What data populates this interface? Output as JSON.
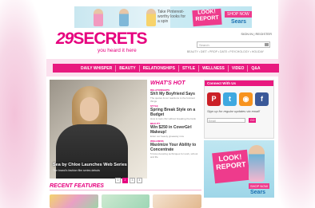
{
  "top_ad": {
    "tagline": "Take Pinterest-worthy looks for a spin",
    "look_report": "LOOK! REPORT",
    "shop_now": "SHOP NOW",
    "brand": "Sears"
  },
  "header": {
    "logo_number": "29",
    "logo_word": "SECRETS",
    "tagline": "you heard it here",
    "sign_in": "SIGN IN | REGISTER",
    "search_placeholder": "Search",
    "trending": "BEAUTY • DIET • PROP • DATE • PSYCHOLOGY • HOLIDAY"
  },
  "nav": {
    "items": [
      "DAILY WHISPER",
      "BEAUTY",
      "RELATIONSHIPS",
      "STYLE",
      "WELLNESS",
      "VIDEO",
      "Q&A"
    ]
  },
  "hero": {
    "caption": "Sea by Chloe Launches Web Series",
    "sub": "The brand's fashion film series debuts",
    "pages": [
      "1",
      "2",
      "3",
      "4"
    ],
    "current_page": "2"
  },
  "whats_hot": {
    "heading": "WHAT'S HOT",
    "items": [
      {
        "category": "RELATIONSHIPS",
        "title": "Sh!t My Boyfriend Says",
        "desc": "The quotes & our reactions to the funniest things"
      },
      {
        "category": "STYLE",
        "title": "Spring Break Style on a Budget",
        "desc": "How to look chic without breaking the bank"
      },
      {
        "category": "BEAUTY",
        "title": "Win $250 in CoverGirl Makeup!",
        "desc": "Enter our beauty giveaway now"
      },
      {
        "category": "WELLNESS",
        "title": "Maximize Your Ability to Concentrate",
        "desc": "5 focus-boosting techniques for work, school and life"
      }
    ]
  },
  "sidebar": {
    "connect_heading": "Connect With Us",
    "social": [
      {
        "name": "pinterest",
        "glyph": "P",
        "color": "#cb2027"
      },
      {
        "name": "twitter",
        "glyph": "t",
        "color": "#3fa9e0"
      },
      {
        "name": "rss",
        "glyph": "◉",
        "color": "#f7931e"
      },
      {
        "name": "facebook",
        "glyph": "f",
        "color": "#3b5998"
      }
    ],
    "signup_text": "Sign up for regular updates via email!",
    "email_placeholder": "Email",
    "go_label": "GO"
  },
  "side_ad": {
    "look_report": "LOOK! REPORT",
    "shop_now": "SHOP NOW",
    "brand": "Sears"
  },
  "recent": {
    "heading": "RECENT FEATURES"
  },
  "colors": {
    "brand_pink": "#e6007e",
    "nav_pink": "#e8197f",
    "ad_blue": "#bfe6f1"
  }
}
